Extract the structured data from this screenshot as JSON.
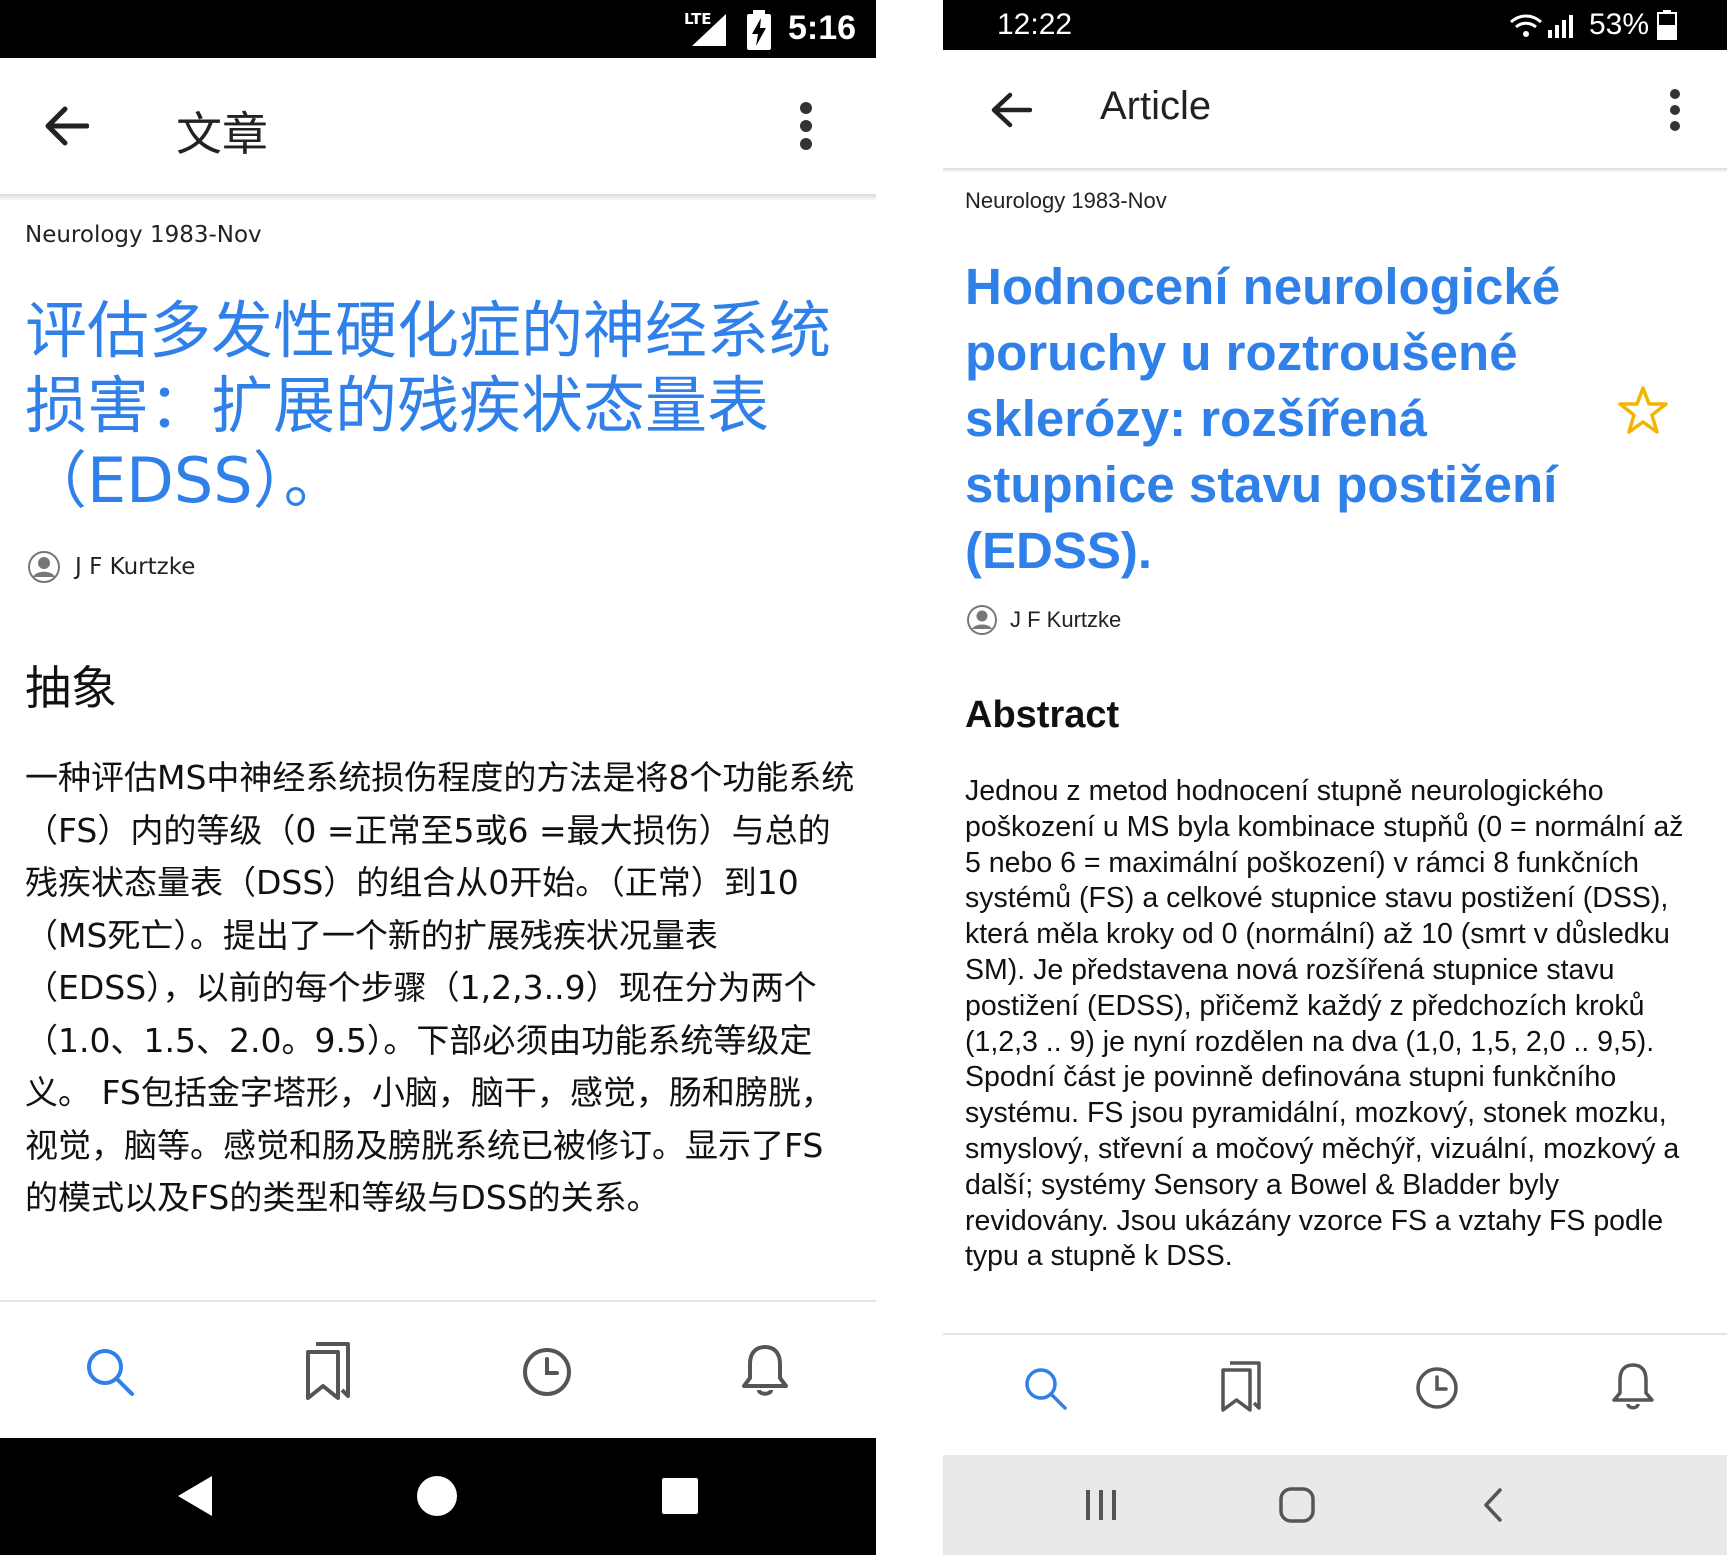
{
  "left": {
    "status": {
      "network": "LTE",
      "time": "5:16"
    },
    "appbar": {
      "title": "文章"
    },
    "journal": "Neurology 1983-Nov",
    "title": "评估多发性硬化症的神经系统损害：扩展的残疾状态量表（EDSS）。",
    "author": "J F Kurtzke",
    "abstract_heading": "抽象",
    "abstract": "一种评估MS中神经系统损伤程度的方法是将8个功能系统（FS）内的等级（0 =正常至5或6 =最大损伤）与总的残疾状态量表（DSS）的组合从0开始。（正常）到10（MS死亡）。提出了一个新的扩展残疾状况量表（EDSS），以前的每个步骤（1,2,3..9）现在分为两个（1.0、1.5、2.0。9.5）。下部必须由功能系统等级定义。 FS包括金字塔形，小脑，脑干，感觉，肠和膀胱，视觉，脑等。感觉和肠及膀胱系统已被修订。显示了FS的模式以及FS的类型和等级与DSS的关系。",
    "nav": [
      "search-icon",
      "bookmarks-icon",
      "history-icon",
      "notifications-icon"
    ]
  },
  "right": {
    "status": {
      "time": "12:22",
      "battery": "53%"
    },
    "appbar": {
      "title": "Article"
    },
    "journal": "Neurology 1983-Nov",
    "title": "Hodnocení neurologické poruchy u roztroušené sklerózy: rozšířená stupnice stavu postižení (EDSS).",
    "author": "J F Kurtzke",
    "abstract_heading": "Abstract",
    "abstract": "Jednou z metod hodnocení stupně neurologického poškození u MS byla kombinace stupňů (0 = normální až 5 nebo 6 = maximální poškození) v rámci 8 funkčních systémů (FS) a celkové stupnice stavu postižení (DSS), která měla kroky od 0 (normální) až 10 (smrt v důsledku SM). Je představena nová rozšířená stupnice stavu postižení (EDSS), přičemž každý z předchozích kroků (1,2,3 .. 9) je nyní rozdělen na dva (1,0, 1,5, 2,0 .. 9,5). Spodní část je povinně definována stupni funkčního systému. FS jsou pyramidální, mozkový, stonek mozku, smyslový, střevní a močový měchýř, vizuální, mozkový a další; systémy Sensory a Bowel & Bladder byly revidovány. Jsou ukázány vzorce FS a vztahy FS podle typu a stupně k DSS.",
    "nav": [
      "search-icon",
      "bookmarks-icon",
      "history-icon",
      "notifications-icon"
    ]
  },
  "colors": {
    "accent": "#2f80e9",
    "star": "#f5b400",
    "status_bar": "#000000"
  }
}
